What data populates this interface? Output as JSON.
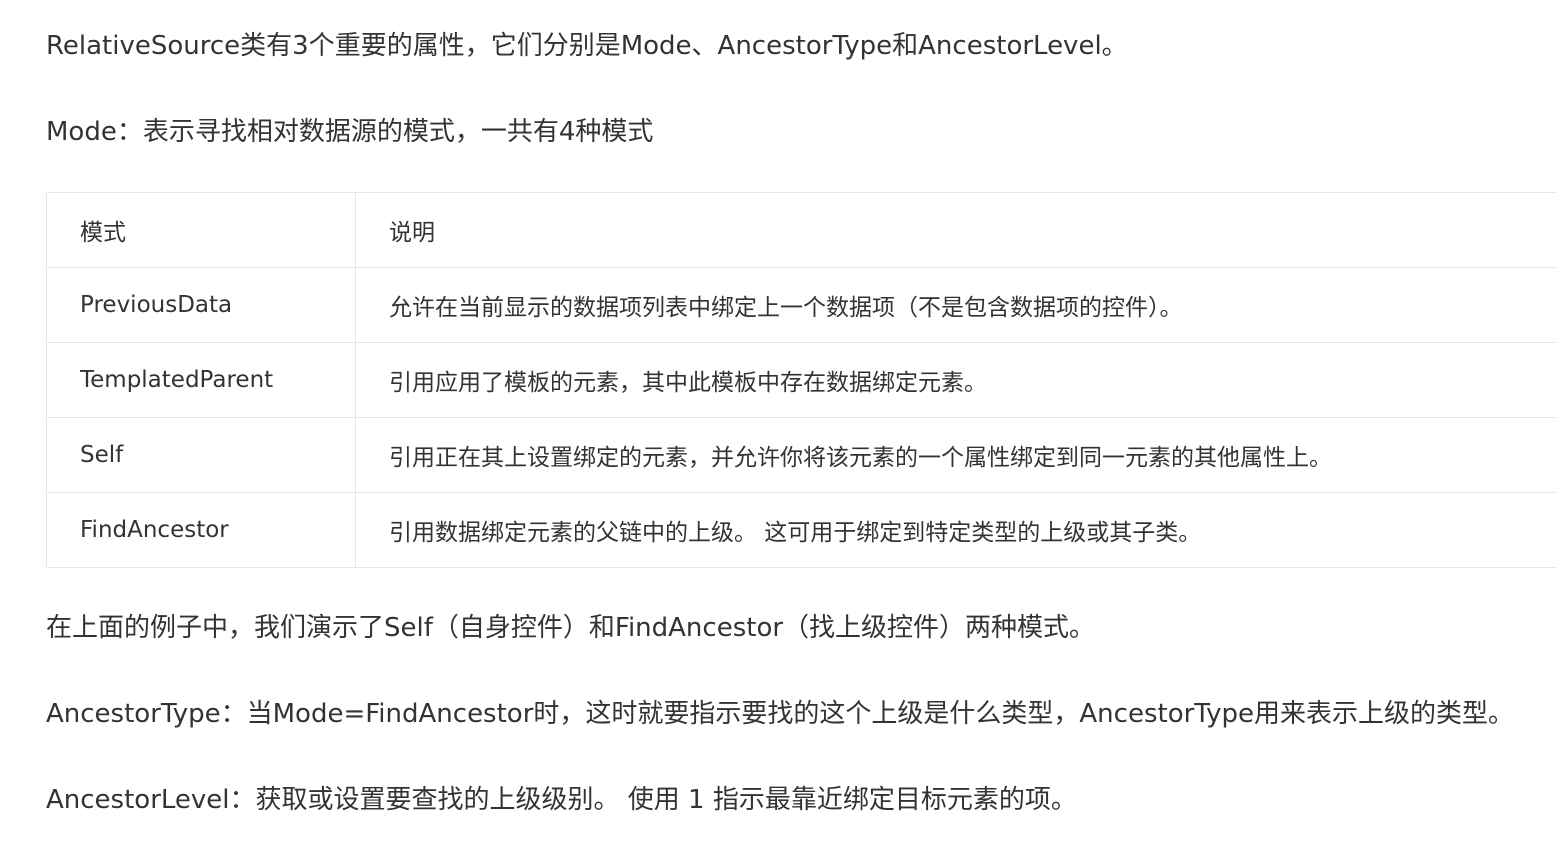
{
  "paragraphs": {
    "intro": "RelativeSource类有3个重要的属性，它们分别是Mode、AncestorType和AncestorLevel。",
    "mode": "Mode：表示寻找相对数据源的模式，一共有4种模式",
    "example": "在上面的例子中，我们演示了Self（自身控件）和FindAncestor（找上级控件）两种模式。",
    "ancestor_type": "AncestorType：当Mode=FindAncestor时，这时就要指示要找的这个上级是什么类型，AncestorType用来表示上级的类型。",
    "ancestor_level": "AncestorLevel：获取或设置要查找的上级级别。 使用 1 指示最靠近绑定目标元素的项。"
  },
  "mode_table": {
    "headers": [
      "模式",
      "说明"
    ],
    "rows": [
      [
        "PreviousData",
        "允许在当前显示的数据项列表中绑定上一个数据项（不是包含数据项的控件）。"
      ],
      [
        "TemplatedParent",
        "引用应用了模板的元素，其中此模板中存在数据绑定元素。"
      ],
      [
        "Self",
        "引用正在其上设置绑定的元素，并允许你将该元素的一个属性绑定到同一元素的其他属性上。"
      ],
      [
        "FindAncestor",
        "引用数据绑定元素的父链中的上级。 这可用于绑定到特定类型的上级或其子类。"
      ]
    ]
  }
}
